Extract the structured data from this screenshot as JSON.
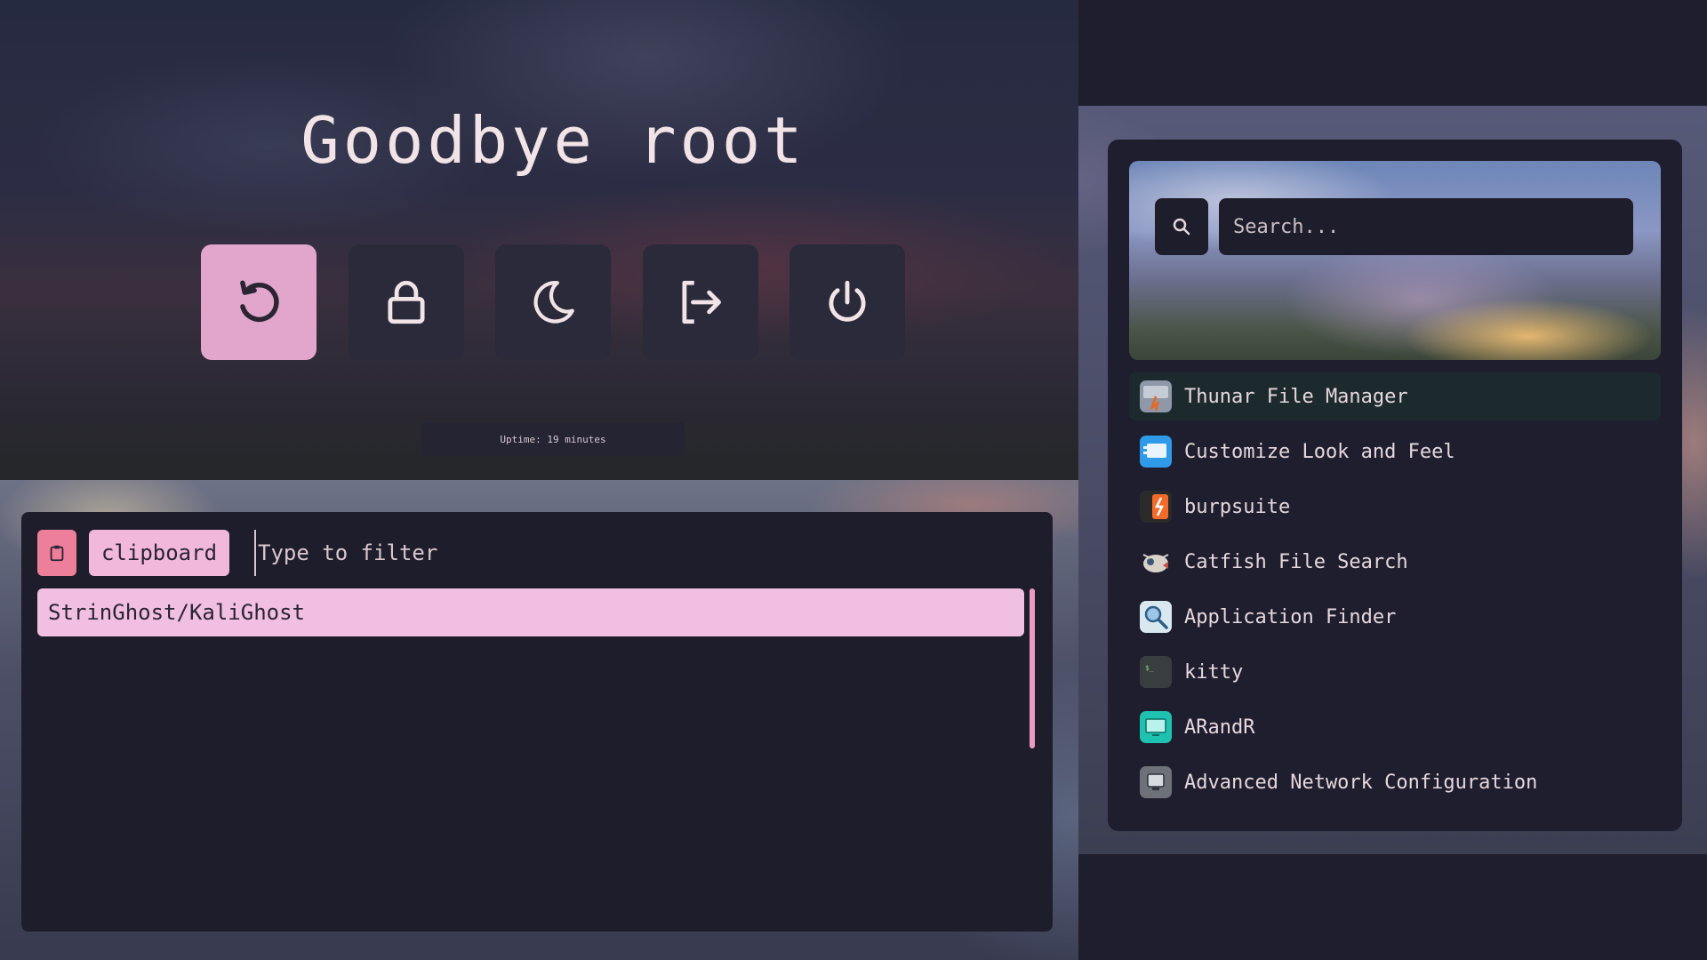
{
  "power_menu": {
    "title": "Goodbye root",
    "buttons": [
      {
        "name": "restart",
        "icon": "restart-icon",
        "active": true
      },
      {
        "name": "lock",
        "icon": "lock-icon",
        "active": false
      },
      {
        "name": "suspend",
        "icon": "moon-icon",
        "active": false
      },
      {
        "name": "logout",
        "icon": "logout-icon",
        "active": false
      },
      {
        "name": "shutdown",
        "icon": "power-icon",
        "active": false
      }
    ],
    "uptime": "Uptime: 19 minutes"
  },
  "clipboard": {
    "mode_label": "clipboard",
    "filter_placeholder": "Type to filter",
    "entries": [
      "StrinGhost/KaliGhost"
    ]
  },
  "launcher": {
    "search_placeholder": "Search...",
    "apps": [
      {
        "label": "Thunar File Manager",
        "icon": "thunar-icon"
      },
      {
        "label": "Customize Look and Feel",
        "icon": "appearance-icon"
      },
      {
        "label": "burpsuite",
        "icon": "burpsuite-icon"
      },
      {
        "label": "Catfish File Search",
        "icon": "catfish-icon"
      },
      {
        "label": "Application Finder",
        "icon": "app-finder-icon"
      },
      {
        "label": "kitty",
        "icon": "terminal-icon"
      },
      {
        "label": "ARandR",
        "icon": "monitor-icon"
      },
      {
        "label": "Advanced Network Configuration",
        "icon": "network-icon"
      }
    ]
  },
  "colors": {
    "accent_pink": "#e2a6cc",
    "clip_pink": "#f1bfe2",
    "clip_icon_red": "#ee7f9b",
    "panel_bg": "#1f1e2e",
    "button_bg": "#2a2a3a",
    "text": "#f1e3e6"
  }
}
